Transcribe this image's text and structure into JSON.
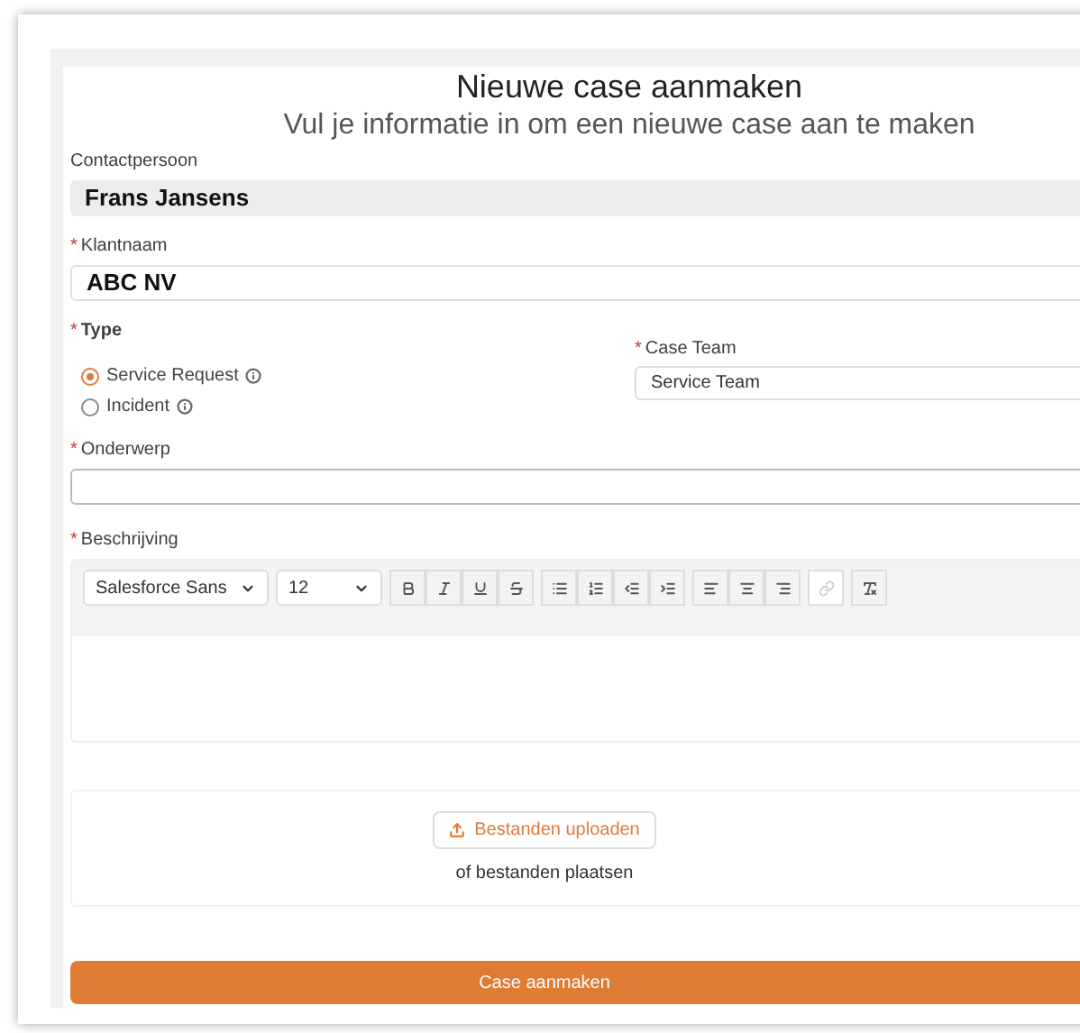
{
  "title": "Nieuwe case aanmaken",
  "subtitle": "Vul je informatie in om een nieuwe case aan te maken",
  "contact": {
    "label": "Contactpersoon",
    "value": "Frans Jansens",
    "disabled": true
  },
  "customer": {
    "label": "Klantnaam",
    "required_mark": "*",
    "value": "ABC NV"
  },
  "type": {
    "label": "Type",
    "required_mark": "*",
    "options": [
      {
        "label": "Service Request",
        "selected": true
      },
      {
        "label": "Incident",
        "selected": false
      }
    ]
  },
  "case_team": {
    "label": "Case Team",
    "required_mark": "*",
    "value": "Service Team"
  },
  "subject": {
    "label": "Onderwerp",
    "required_mark": "*"
  },
  "description": {
    "label": "Beschrijving",
    "required_mark": "*",
    "font": "Salesforce Sans",
    "size": "12",
    "toolbar": [
      [
        {
          "kind": "bold",
          "disabled": false
        },
        {
          "kind": "italic",
          "disabled": false
        },
        {
          "kind": "underline",
          "disabled": false
        },
        {
          "kind": "strike",
          "disabled": false
        }
      ],
      [
        {
          "kind": "bullets",
          "disabled": false
        },
        {
          "kind": "numbered",
          "disabled": false
        },
        {
          "kind": "outdent",
          "disabled": false
        },
        {
          "kind": "indent",
          "disabled": false
        }
      ],
      [
        {
          "kind": "align-left",
          "disabled": false
        },
        {
          "kind": "align-center",
          "disabled": false
        },
        {
          "kind": "align-right",
          "disabled": false
        }
      ],
      [
        {
          "kind": "link",
          "disabled": true
        }
      ],
      [
        {
          "kind": "clear",
          "disabled": false
        }
      ]
    ]
  },
  "upload": {
    "button": "Bestanden uploaden",
    "hint": "of bestanden plaatsen"
  },
  "submit": "Case aanmaken"
}
